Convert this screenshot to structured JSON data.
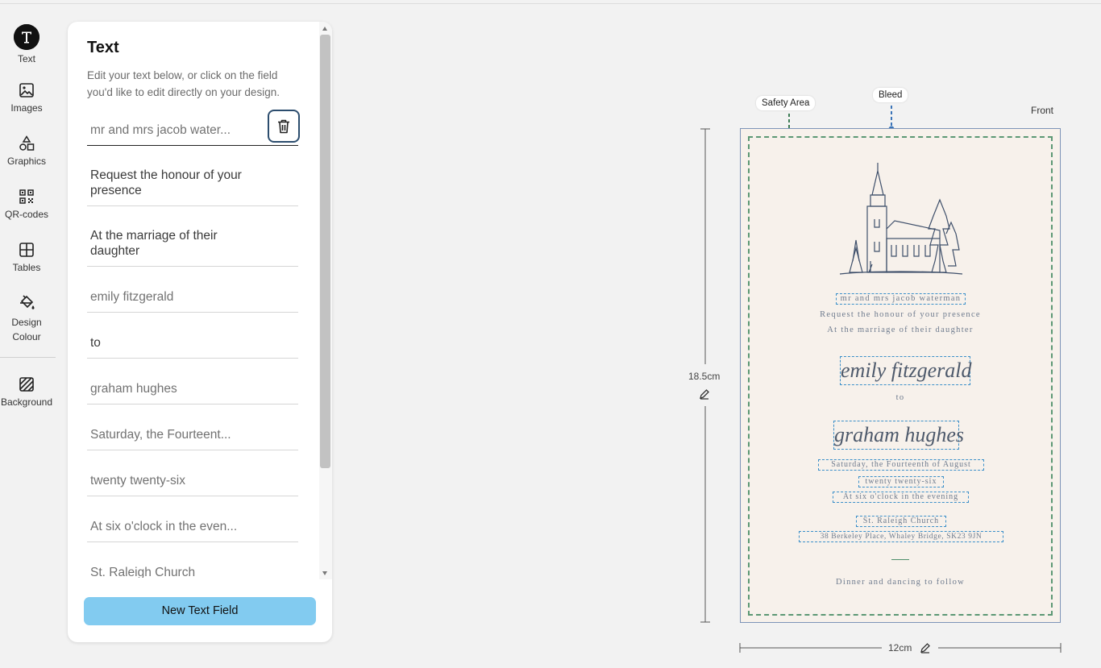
{
  "rail": {
    "items": [
      {
        "label": "Text",
        "icon": "text-icon",
        "active": true
      },
      {
        "label": "Images",
        "icon": "image-icon"
      },
      {
        "label": "Graphics",
        "icon": "shapes-icon"
      },
      {
        "label": "QR-codes",
        "icon": "qr-code-icon"
      },
      {
        "label": "Tables",
        "icon": "table-icon"
      },
      {
        "label": "Design\nColour",
        "icon": "paint-bucket-icon"
      },
      {
        "label": "Background",
        "icon": "pattern-icon"
      }
    ]
  },
  "panel": {
    "title": "Text",
    "description": "Edit your text below, or click on the field you'd like to edit directly on your design.",
    "fields": [
      "mr and mrs jacob water...",
      "Request the honour of your presence",
      "At the marriage of their daughter",
      "emily fitzgerald",
      "to",
      "graham hughes",
      "Saturday, the Fourteent...",
      "twenty twenty-six",
      "At six o'clock in the even...",
      "St. Raleigh Church"
    ],
    "new_field_button": "New Text Field"
  },
  "canvas": {
    "safety_area_label": "Safety Area",
    "bleed_label": "Bleed",
    "side_label": "Front",
    "height_label": "18.5cm",
    "width_label": "12cm",
    "colors": {
      "card": "#f7f1eb",
      "bleed": "#7d94b8",
      "safety": "#5c9874",
      "selection": "#3a8fc9",
      "accent": "#82cbf0"
    }
  },
  "card_text": {
    "parents": "mr and mrs jacob waterman",
    "request": "Request the honour of your presence",
    "marriage": "At the marriage of their daughter",
    "bride": "emily fitzgerald",
    "to": "to",
    "groom": "graham hughes",
    "date": "Saturday, the Fourteenth of August",
    "year": "twenty twenty-six",
    "time": "At six o'clock in the evening",
    "venue": "St. Raleigh Church",
    "address": "38 Berkeley Place, Whaley Bridge, SK23 9JN",
    "footer": "Dinner and dancing to follow"
  }
}
